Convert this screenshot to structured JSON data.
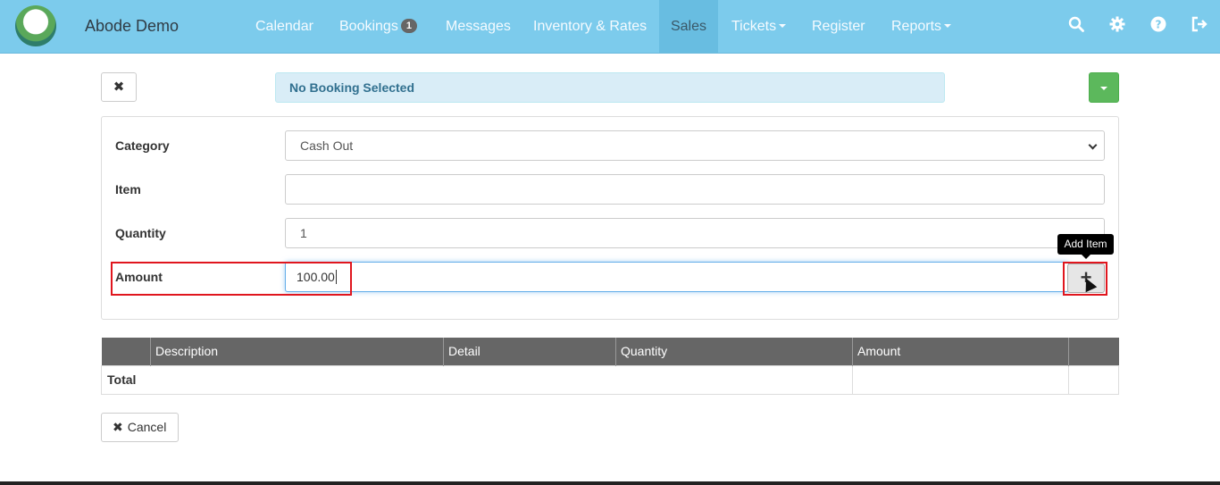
{
  "app": {
    "brand": "Abode Demo"
  },
  "nav": {
    "items": [
      {
        "label": "Calendar"
      },
      {
        "label": "Bookings",
        "badge": "1"
      },
      {
        "label": "Messages"
      },
      {
        "label": "Inventory & Rates"
      },
      {
        "label": "Sales"
      },
      {
        "label": "Tickets"
      },
      {
        "label": "Register"
      },
      {
        "label": "Reports"
      }
    ],
    "icons": [
      "search-icon",
      "gear-icon",
      "help-icon",
      "sign-out-icon"
    ]
  },
  "toolbar": {
    "close_glyph": "✖",
    "alert_text": "No Booking Selected"
  },
  "form": {
    "category_label": "Category",
    "category_value": "Cash Out",
    "item_label": "Item",
    "item_value": "",
    "quantity_label": "Quantity",
    "quantity_value": "1",
    "amount_label": "Amount",
    "amount_value": "100.00",
    "add_glyph": "+",
    "add_tooltip": "Add Item"
  },
  "table": {
    "headers": [
      "",
      "Description",
      "Detail",
      "Quantity",
      "Amount",
      ""
    ],
    "total_label": "Total"
  },
  "footer": {
    "cancel_label": "Cancel",
    "cancel_glyph": "✖"
  },
  "colors": {
    "navbar": "#7ccbec",
    "success": "#5cb85c",
    "info_bg": "#d9edf7",
    "highlight": "#e0161e"
  }
}
